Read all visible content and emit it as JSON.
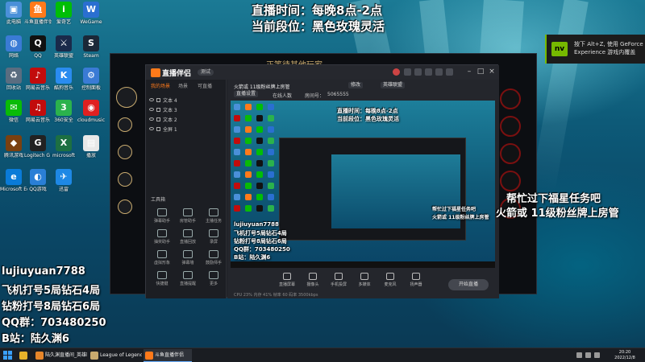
{
  "overlay": {
    "schedule": "直播时间：每晚8点-2点",
    "rank": "当前段位：黑色玫瑰灵活",
    "request_line1": "帮忙过下福星任务吧",
    "request_line2": "火箭或 11级粉丝牌上房管",
    "streamer_id": "lujiuyuan7788",
    "pricing_line1": "飞机打号5局钻石4局",
    "pricing_line2": "钻粉打号8局钻石6局",
    "qq_group": "QQ群：703480250",
    "bilibili": "B站：陆久渊6"
  },
  "desktop_icons": [
    {
      "label": "此电脑",
      "color": "#4a90d9",
      "glyph": "▣"
    },
    {
      "label": "斗鱼直播伴侣",
      "color": "#ff7a1a",
      "glyph": "鱼"
    },
    {
      "label": "爱奇艺",
      "color": "#00be06",
      "glyph": "i"
    },
    {
      "label": "WeGame",
      "color": "#2a6fd1",
      "glyph": "W"
    },
    {
      "label": "网络",
      "color": "#3a7bd5",
      "glyph": "◍"
    },
    {
      "label": "QQ",
      "color": "#111111",
      "glyph": "Q"
    },
    {
      "label": "英雄联盟",
      "color": "#1a2a4a",
      "glyph": "⚔"
    },
    {
      "label": "Steam",
      "color": "#1b2838",
      "glyph": "S"
    },
    {
      "label": "回收站",
      "color": "#5a6d80",
      "glyph": "♻"
    },
    {
      "label": "网易云音乐",
      "color": "#c20c0c",
      "glyph": "♪"
    },
    {
      "label": "酷狗音乐",
      "color": "#2a8cf0",
      "glyph": "K"
    },
    {
      "label": "控制面板",
      "color": "#3a7bd5",
      "glyph": "⚙"
    },
    {
      "label": "微信",
      "color": "#09bb07",
      "glyph": "✉"
    },
    {
      "label": "网易云音乐",
      "color": "#c20c0c",
      "glyph": "♫"
    },
    {
      "label": "360安全",
      "color": "#2bb24c",
      "glyph": "3"
    },
    {
      "label": "cloudmusic",
      "color": "#e02020",
      "glyph": "◉"
    },
    {
      "label": "腾讯游戏",
      "color": "#7a4010",
      "glyph": "◆"
    },
    {
      "label": "Logitech G HUB",
      "color": "#222222",
      "glyph": "G"
    },
    {
      "label": "microsoft",
      "color": "#1d6f42",
      "glyph": "X"
    },
    {
      "label": "播放",
      "color": "#e8e8e8",
      "glyph": "▤"
    },
    {
      "label": "Microsoft Edge",
      "color": "#0a7bd8",
      "glyph": "e"
    },
    {
      "label": "QQ游戏",
      "color": "#2a7fd6",
      "glyph": "◐"
    },
    {
      "label": "迅雷",
      "color": "#1e88e5",
      "glyph": "✈"
    }
  ],
  "toast": {
    "text": "按下 Alt+Z, 使用 GeForce Experience 游戏内覆盖",
    "logo": "nvidia-icon"
  },
  "game_window": {
    "title": "正等待其他玩家"
  },
  "app": {
    "name": "直播伴侣",
    "version": "测试",
    "sidebar_tabs": [
      "我的场景",
      "场景",
      "可直播"
    ],
    "scenes": [
      "文本 4",
      "文本 3",
      "文本 2",
      "全屏 1"
    ],
    "tools_title": "工具箱",
    "tools": [
      "弹幕助手",
      "房管助手",
      "主播任务",
      "抽奖助手",
      "直播回放",
      "录屏",
      "虚拟形象",
      "弹幕墙",
      "鼓励师手",
      "快捷键",
      "直播提醒",
      "更多"
    ],
    "room_title": "火箭或 11级粉丝牌上房管",
    "room_edit": "修改",
    "room_category": "英雄联盟",
    "room_id_label": "房间号：",
    "room_id": "5065555",
    "status_online": "在线人数",
    "stream_settings": "直播设置",
    "preview_overlay_line1": "直播时间：每晚8点-2点",
    "preview_overlay_line2": "当前段位：黑色玫瑰灵活",
    "preview_request_line1": "帮忙过下福星任务吧",
    "preview_request_line2": "火箭或 11级粉丝牌上房管",
    "controls": [
      "直播屏幕",
      "摄像头",
      "手机投屏",
      "多媒体",
      "麦克风",
      "扬声器"
    ],
    "start_live": "开始直播",
    "status_bar": "CPU 23%  内存 41%  帧率 60  码率 3500kbps"
  },
  "game_right_buttons": 5,
  "taskbar": {
    "apps": [
      {
        "label": "陆久渊直播间_英雄联...",
        "color": "#e8862a"
      },
      {
        "label": "League of Legends",
        "color": "#c8aa6e"
      },
      {
        "label": "斗鱼直播伴侣",
        "color": "#ff7a1a"
      }
    ],
    "time": "20:20",
    "date": "2022/12/8"
  }
}
